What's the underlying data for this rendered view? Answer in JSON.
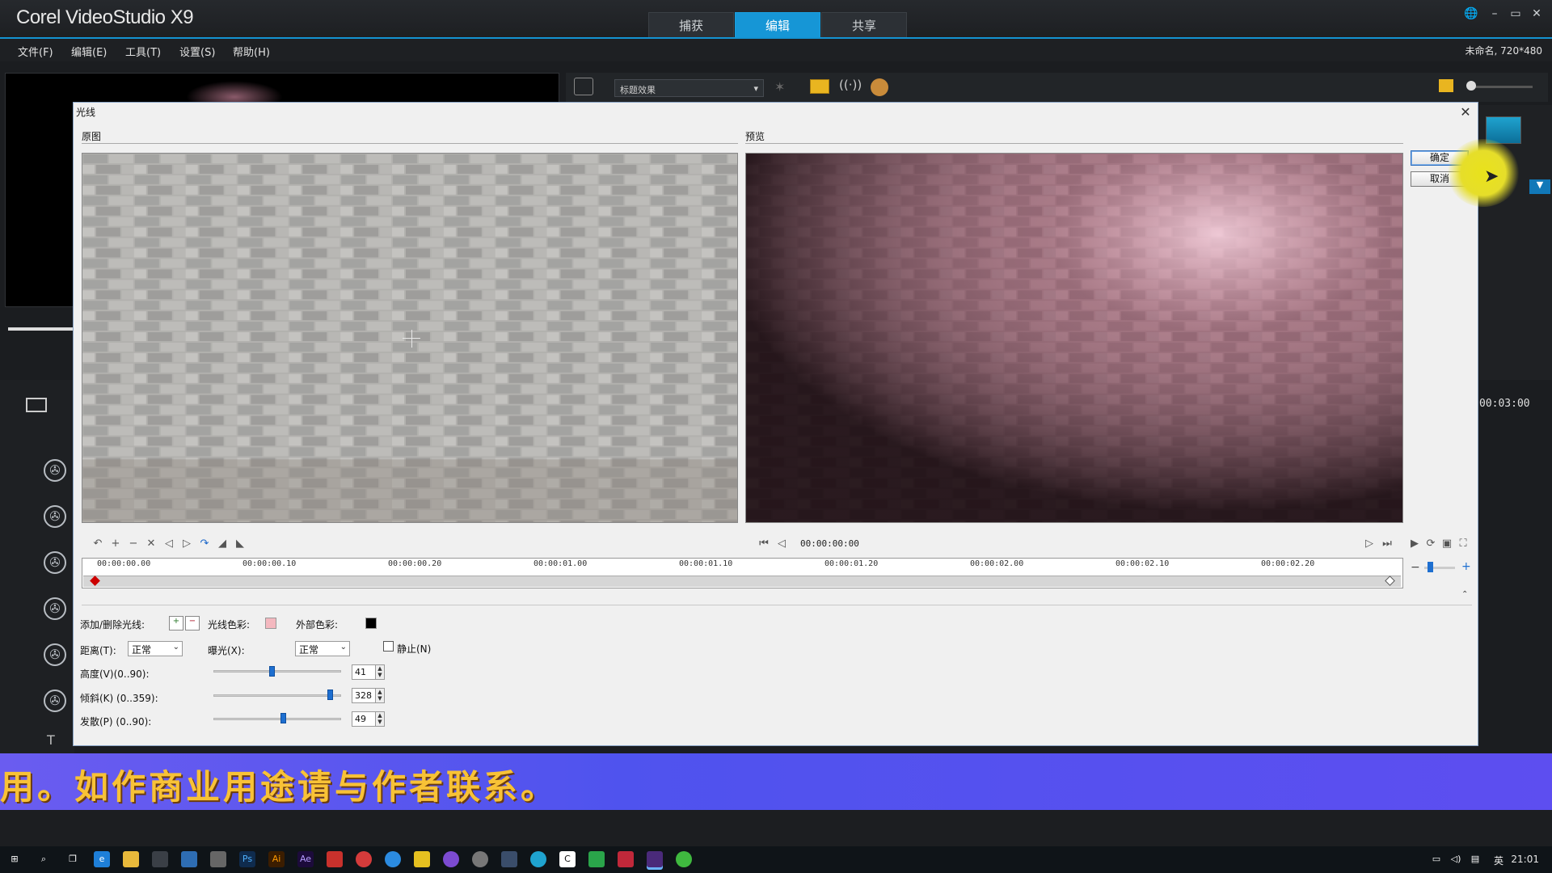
{
  "app": {
    "logo": "Corel VideoStudio X9",
    "tabs": [
      "捕获",
      "编辑",
      "共享"
    ],
    "active_tab": "编辑",
    "project_info": "未命名, 720*480",
    "accent_color": "#1696d6"
  },
  "menu": {
    "items": [
      "文件(F)",
      "编辑(E)",
      "工具(T)",
      "设置(S)",
      "帮助(H)"
    ]
  },
  "library": {
    "effects_dropdown": "标题效果",
    "timecode": "00:03:00"
  },
  "dialog": {
    "title": "光线",
    "original_label": "原图",
    "preview_label": "预览",
    "ok_label": "确定",
    "cancel_label": "取消",
    "time_display": "00:00:00:00",
    "ruler_labels": [
      "00:00:00.00",
      "00:00:00.10",
      "00:00:00.20",
      "00:00:01.00",
      "00:00:01.10",
      "00:00:01.20",
      "00:00:02.00",
      "00:00:02.10",
      "00:00:02.20"
    ],
    "controls": {
      "add_remove_label": "添加/删除光线:",
      "light_color_label": "光线色彩:",
      "light_color": "#f4b8bf",
      "external_color_label": "外部色彩:",
      "external_color": "#000000",
      "distance_label": "距离(T):",
      "distance_value": "正常",
      "exposure_label": "曝光(X):",
      "exposure_value": "正常",
      "static_label": "静止(N)",
      "height_label": "高度(V)(0..90):",
      "height_value": "41",
      "tilt_label": "倾斜(K) (0..359):",
      "tilt_value": "328",
      "spread_label": "发散(P) (0..90):",
      "spread_value": "49"
    },
    "sliders": {
      "height": 0.4556,
      "tilt": 0.9136,
      "spread": 0.5444
    }
  },
  "banner": {
    "text": "用。如作商业用途请与作者联系。"
  },
  "taskbar": {
    "ime": "英",
    "clock": "21:01"
  }
}
